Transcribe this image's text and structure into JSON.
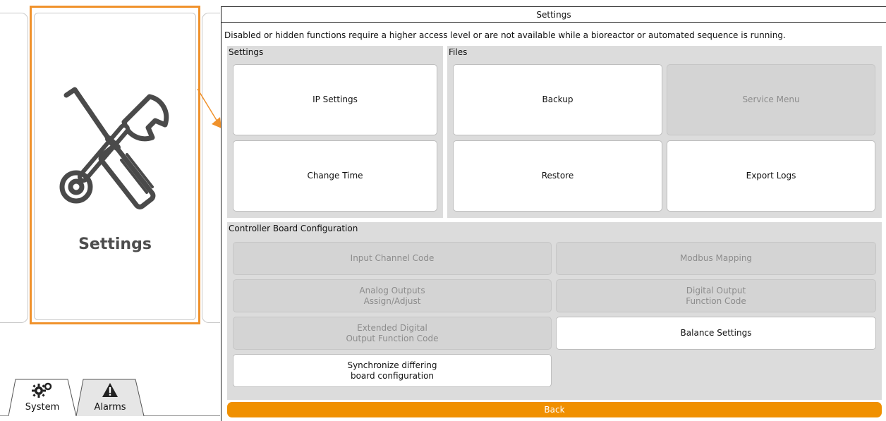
{
  "left": {
    "tile_label": "Settings",
    "tile_icon": "wrench-screwdriver-icon",
    "tabs": [
      {
        "label": "System",
        "icon": "gears-icon"
      },
      {
        "label": "Alarms",
        "icon": "warning-icon"
      }
    ]
  },
  "panel": {
    "title": "Settings",
    "notice": "Disabled or hidden functions require a higher access level or are not available while a bioreactor or automated sequence is running.",
    "settings_group": {
      "title": "Settings",
      "buttons": [
        {
          "label": "IP Settings",
          "enabled": true
        },
        {
          "label": "Change Time",
          "enabled": true
        }
      ]
    },
    "files_group": {
      "title": "Files",
      "buttons": [
        {
          "label": "Backup",
          "enabled": true
        },
        {
          "label": "Service Menu",
          "enabled": false
        },
        {
          "label": "Restore",
          "enabled": true
        },
        {
          "label": "Export Logs",
          "enabled": true
        }
      ]
    },
    "board_group": {
      "title": "Controller Board Configuration",
      "buttons": [
        {
          "label": "Input Channel Code",
          "enabled": false
        },
        {
          "label": "Modbus Mapping",
          "enabled": false
        },
        {
          "label": "Analog Outputs\nAssign/Adjust",
          "enabled": false
        },
        {
          "label": "Digital Output\nFunction Code",
          "enabled": false
        },
        {
          "label": "Extended Digital\nOutput Function Code",
          "enabled": false
        },
        {
          "label": "Balance Settings",
          "enabled": true
        },
        {
          "label": "Synchronize differing\nboard configuration",
          "enabled": true
        }
      ]
    },
    "back_label": "Back"
  },
  "colors": {
    "accent_orange": "#f09000",
    "highlight_orange": "#f0922c",
    "group_bg": "#dcdcdc",
    "disabled_bg": "#d4d4d4",
    "disabled_text": "#8c8c8c"
  }
}
